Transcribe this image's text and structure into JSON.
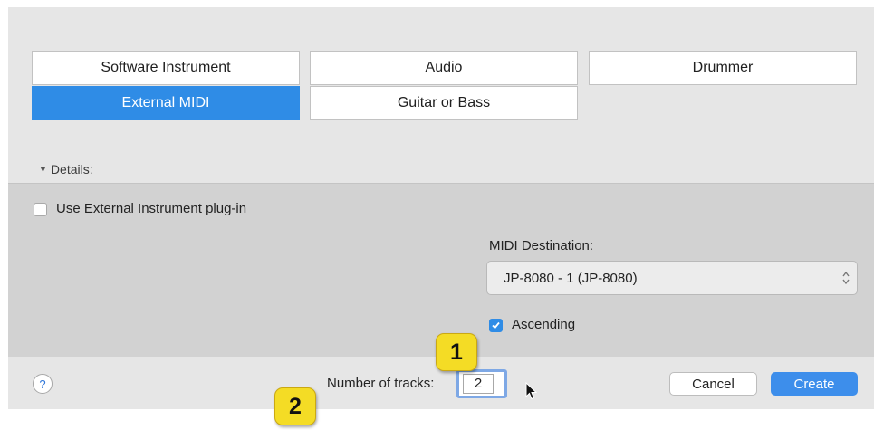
{
  "track_types": {
    "software_instrument": "Software Instrument",
    "audio": "Audio",
    "drummer": "Drummer",
    "external_midi": "External MIDI",
    "guitar_or_bass": "Guitar or Bass",
    "selected": "External MIDI"
  },
  "details": {
    "toggle_label": "Details:",
    "use_external_instrument": {
      "label": "Use External Instrument plug-in",
      "checked": false
    },
    "midi_destination": {
      "label": "MIDI Destination:",
      "value": "JP-8080 - 1 (JP-8080)"
    },
    "ascending": {
      "label": "Ascending",
      "checked": true
    }
  },
  "footer": {
    "help_label": "?",
    "tracks_label": "Number of tracks:",
    "tracks_value": "2",
    "cancel_label": "Cancel",
    "create_label": "Create"
  },
  "callouts": {
    "one": "1",
    "two": "2"
  },
  "colors": {
    "accent": "#2f8ce6",
    "callout": "#f4dc25",
    "panel": "#e6e6e6",
    "details_panel": "#d2d2d2"
  }
}
